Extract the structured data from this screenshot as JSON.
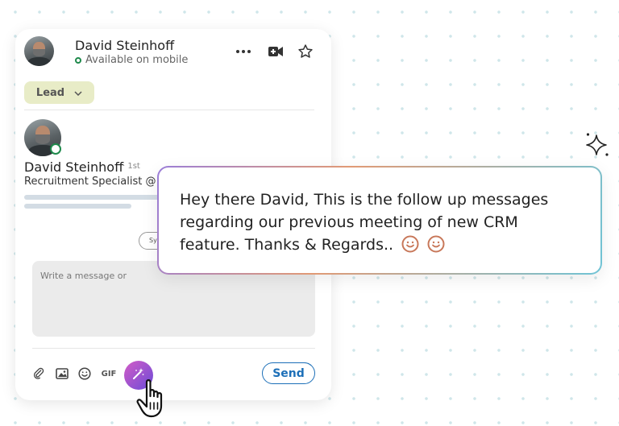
{
  "profile": {
    "name": "David Steinhoff",
    "status": "Available on mobile",
    "lead_label": "Lead",
    "full_name": "David Steinhoff",
    "degree": "· 1st",
    "title": "Recruitment Specialist @"
  },
  "composer": {
    "pill_text": "Sy",
    "placeholder": "Write a message or",
    "gif_label": "GIF",
    "send_label": "Send"
  },
  "bubble": {
    "text": "Hey there David, This is the follow up messages regarding our previous meeting of new CRM feature. Thanks & Regards.."
  },
  "icons": {
    "more": "more-horizontal-icon",
    "video": "video-call-icon",
    "star": "star-icon",
    "attach": "paperclip-icon",
    "image": "image-icon",
    "emoji": "emoji-icon",
    "ai": "magic-wand-icon",
    "cursor": "hand-pointer-icon",
    "sparkle": "sparkle-icon"
  },
  "colors": {
    "online": "#1f8a4c",
    "lead_bg": "#e8ecc7",
    "send": "#1c6fb8",
    "ai_gradient_start": "#d35cc6",
    "ai_gradient_end": "#6b4bd8"
  }
}
